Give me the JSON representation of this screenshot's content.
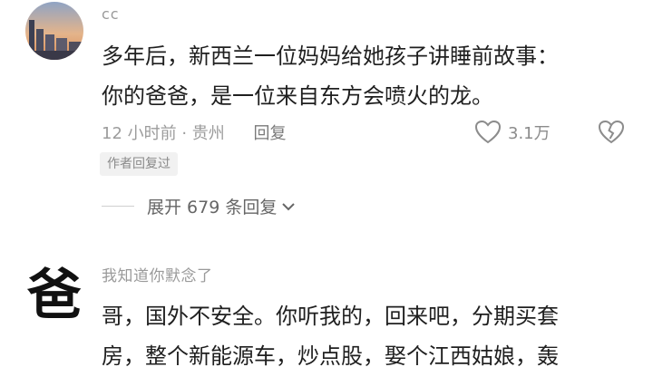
{
  "comment1": {
    "username": "cc",
    "lines": [
      "多年后，新西兰一位妈妈给她孩子讲睡前故事：",
      "你的爸爸，是一位来自东方会喷火的龙。"
    ],
    "time": "12 小时前 · 贵州",
    "reply_label": "回复",
    "likes": "3.1万",
    "author_badge": "作者回复过",
    "expand_label": "展开 679 条回复",
    "icons": [
      "heart-icon",
      "broken-heart-icon",
      "chevron-down-icon"
    ]
  },
  "comment2": {
    "avatar_char": "爸",
    "username": "我知道你默念了",
    "lines": [
      "哥，国外不安全。你听我的，回来吧，分期买套",
      "房，整个新能源车，炒点股，娶个江西姑娘，轰"
    ]
  }
}
